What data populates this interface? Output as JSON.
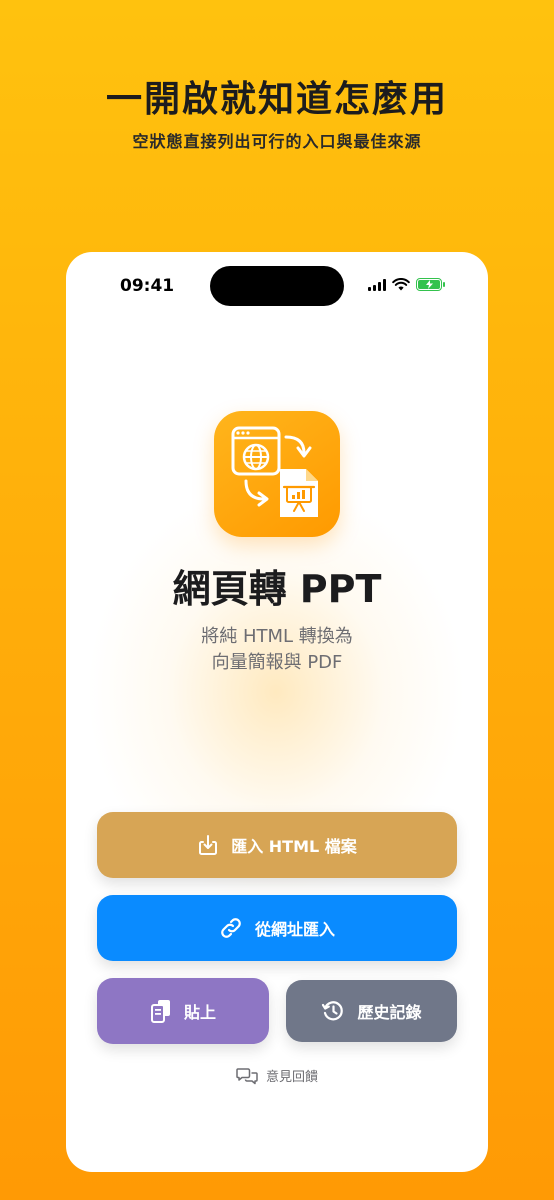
{
  "promo": {
    "headline": "一開啟就知道怎麼用",
    "subline": "空狀態直接列出可行的入口與最佳來源"
  },
  "status_bar": {
    "time": "09:41",
    "icons": [
      "signal-icon",
      "wifi-icon",
      "battery-charging-icon"
    ]
  },
  "app": {
    "icon": "webpage-to-presentation-icon",
    "title": "網頁轉 PPT",
    "description_line1": "將純 HTML 轉換為",
    "description_line2": "向量簡報與 PDF"
  },
  "actions": {
    "import_html": {
      "label": "匯入 HTML 檔案",
      "icon": "download-tray-icon",
      "color": "#d7a555"
    },
    "import_url": {
      "label": "從網址匯入",
      "icon": "link-icon",
      "color": "#0a8bff"
    },
    "paste": {
      "label": "貼上",
      "icon": "clipboard-icon",
      "color": "#8e76c4"
    },
    "history": {
      "label": "歷史記錄",
      "icon": "history-clock-icon",
      "color": "#707789"
    }
  },
  "feedback": {
    "label": "意見回饋",
    "icon": "chat-bubbles-icon"
  },
  "colors": {
    "background_top": "#ffc20e",
    "background_bottom": "#ff9a05",
    "accent": "#ff9a00"
  }
}
